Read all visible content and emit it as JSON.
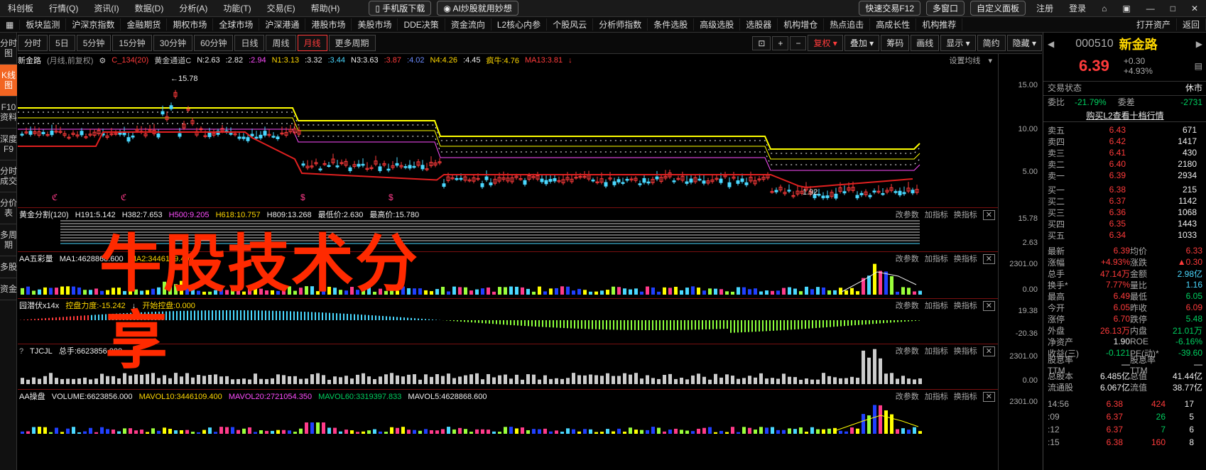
{
  "menubar": {
    "items": [
      "科创板",
      "行情(Q)",
      "资讯(I)",
      "数据(D)",
      "分析(A)",
      "功能(T)",
      "交易(E)",
      "帮助(H)"
    ],
    "mobile": "手机版下载",
    "ai": "AI炒股就用妙想",
    "fast_trade": "快速交易F12",
    "multi": "多窗口",
    "custom": "自定义面板",
    "register": "注册",
    "login": "登录"
  },
  "navbar": {
    "items": [
      "板块监测",
      "沪深京指数",
      "金融期货",
      "期权市场",
      "全球市场",
      "沪深港通",
      "港股市场",
      "美股市场",
      "DDE决策",
      "资金流向",
      "L2核心内参",
      "个股风云",
      "分析师指数",
      "条件选股",
      "高级选股",
      "选股器",
      "机构增仓",
      "热点追击",
      "高成长性",
      "机构推荐"
    ],
    "open_assets": "打开资产",
    "back": "返回"
  },
  "leftbar": [
    "分时图",
    "K线图",
    "F10资料",
    "深度F9",
    "分时成交",
    "分价表",
    "多周期",
    "多股",
    "资金"
  ],
  "periods": [
    "分时",
    "5日",
    "5分钟",
    "15分钟",
    "30分钟",
    "60分钟",
    "日线",
    "周线",
    "月线",
    "更多周期"
  ],
  "active_period": "月线",
  "tools": [
    "复权",
    "叠加",
    "筹码",
    "画线",
    "显示",
    "简约",
    "隐藏"
  ],
  "legend": {
    "name": "新金路",
    "mode": "(月线,前复权)",
    "indicator": "C_134(20)",
    "gold": "黄金通道C",
    "n2": "N:2.63",
    "v1": ":2.82",
    "v2": ":2.94",
    "n1": "N1:3.13",
    "v3": ":3.32",
    "v4": ":3.44",
    "n3": "N3:3.63",
    "v5": ":3.87",
    "v6": ":4.02",
    "n4": "N4:4.26",
    "v7": ":4.45",
    "crazy": "疯牛:4.76",
    "ma13": "MA13:3.81",
    "settings": "设置均线"
  },
  "main_axis": [
    "15.00",
    "10.00",
    "5.00"
  ],
  "high_label": "15.78",
  "low_label": "1.92",
  "sub1": {
    "title": "黄金分割(120)",
    "h191": "H191:5.142",
    "h382": "H382:7.653",
    "h500": "H500:9.205",
    "h618": "H618:10.757",
    "h809": "H809:13.268",
    "low": "最低价:2.630",
    "high": "最高价:15.780",
    "axis": [
      "15.78",
      "2.63"
    ]
  },
  "sub2": {
    "title": "AA五彩量",
    "ma1": "MA1:4628868.600",
    "ma2": "MA2:3446109.400",
    "axis": [
      "2301.00",
      "0.00"
    ]
  },
  "sub3": {
    "title": "园潜伏x14x",
    "a": "控盘力度:-15.242",
    "b": "开始控盘:0.000",
    "axis": [
      "19.38",
      "-20.36"
    ]
  },
  "sub4": {
    "title": "TJCJL",
    "a": "总手:6623856.000",
    "axis": [
      "2301.00",
      "0.00"
    ]
  },
  "sub5": {
    "title": "AA操盘",
    "vol": "VOLUME:6623856.000",
    "m10": "MAVOL10:3446109.400",
    "m20": "MAVOL20:2721054.350",
    "m60": "MAVOL60:3319397.833",
    "m5": "MAVOL5:4628868.600",
    "axis": [
      "2301.00"
    ]
  },
  "subtools": {
    "a": "改参数",
    "b": "加指标",
    "c": "换指标",
    "x": "✕"
  },
  "overlay": {
    "line1": "牛股技术分",
    "line2": "享"
  },
  "quote": {
    "code": "000510",
    "name": "新金路",
    "price": "6.39",
    "chg": "+0.30",
    "pct": "+4.93%",
    "state_label": "交易状态",
    "state": "休市",
    "wb_label": "委比",
    "wb": "-21.79%",
    "wc_label": "委差",
    "wc": "-2731",
    "l2": "购买L2查看十档行情",
    "asks": [
      {
        "l": "卖五",
        "p": "6.43",
        "v": "671"
      },
      {
        "l": "卖四",
        "p": "6.42",
        "v": "1417"
      },
      {
        "l": "卖三",
        "p": "6.41",
        "v": "430"
      },
      {
        "l": "卖二",
        "p": "6.40",
        "v": "2180"
      },
      {
        "l": "卖一",
        "p": "6.39",
        "v": "2934"
      }
    ],
    "bids": [
      {
        "l": "买一",
        "p": "6.38",
        "v": "215"
      },
      {
        "l": "买二",
        "p": "6.37",
        "v": "1142"
      },
      {
        "l": "买三",
        "p": "6.36",
        "v": "1068"
      },
      {
        "l": "买四",
        "p": "6.35",
        "v": "1443"
      },
      {
        "l": "买五",
        "p": "6.34",
        "v": "1033"
      }
    ],
    "stats": [
      [
        "最新",
        "6.39",
        "均价",
        "6.33"
      ],
      [
        "涨幅",
        "+4.93%",
        "涨跌",
        "▲0.30"
      ],
      [
        "总手",
        "47.14万",
        "金额",
        "2.98亿"
      ],
      [
        "换手*",
        "7.77%",
        "量比",
        "1.16"
      ],
      [
        "最高",
        "6.49",
        "最低",
        "6.05"
      ],
      [
        "今开",
        "6.05",
        "昨收",
        "6.09"
      ],
      [
        "涨停",
        "6.70",
        "跌停",
        "5.48"
      ],
      [
        "外盘",
        "26.13万",
        "内盘",
        "21.01万"
      ],
      [
        "净资产",
        "1.90",
        "ROE",
        "-6.16%"
      ],
      [
        "收益(三)",
        "-0.121",
        "PE(动)*",
        "-39.60"
      ],
      [
        "股息率TTM",
        "—",
        "股息率TTM",
        "—"
      ],
      [
        "总股本",
        "6.485亿",
        "总值",
        "41.44亿"
      ],
      [
        "流通股",
        "6.067亿",
        "流值",
        "38.77亿"
      ]
    ],
    "ticks": [
      {
        "t": "14:56",
        "p": "6.38",
        "v": "424",
        "n": "17"
      },
      {
        "t": ":09",
        "p": "6.37",
        "v": "26",
        "n": "5"
      },
      {
        "t": ":12",
        "p": "6.37",
        "v": "7",
        "n": "6"
      },
      {
        "t": ":15",
        "p": "6.38",
        "v": "160",
        "n": "8"
      }
    ]
  }
}
